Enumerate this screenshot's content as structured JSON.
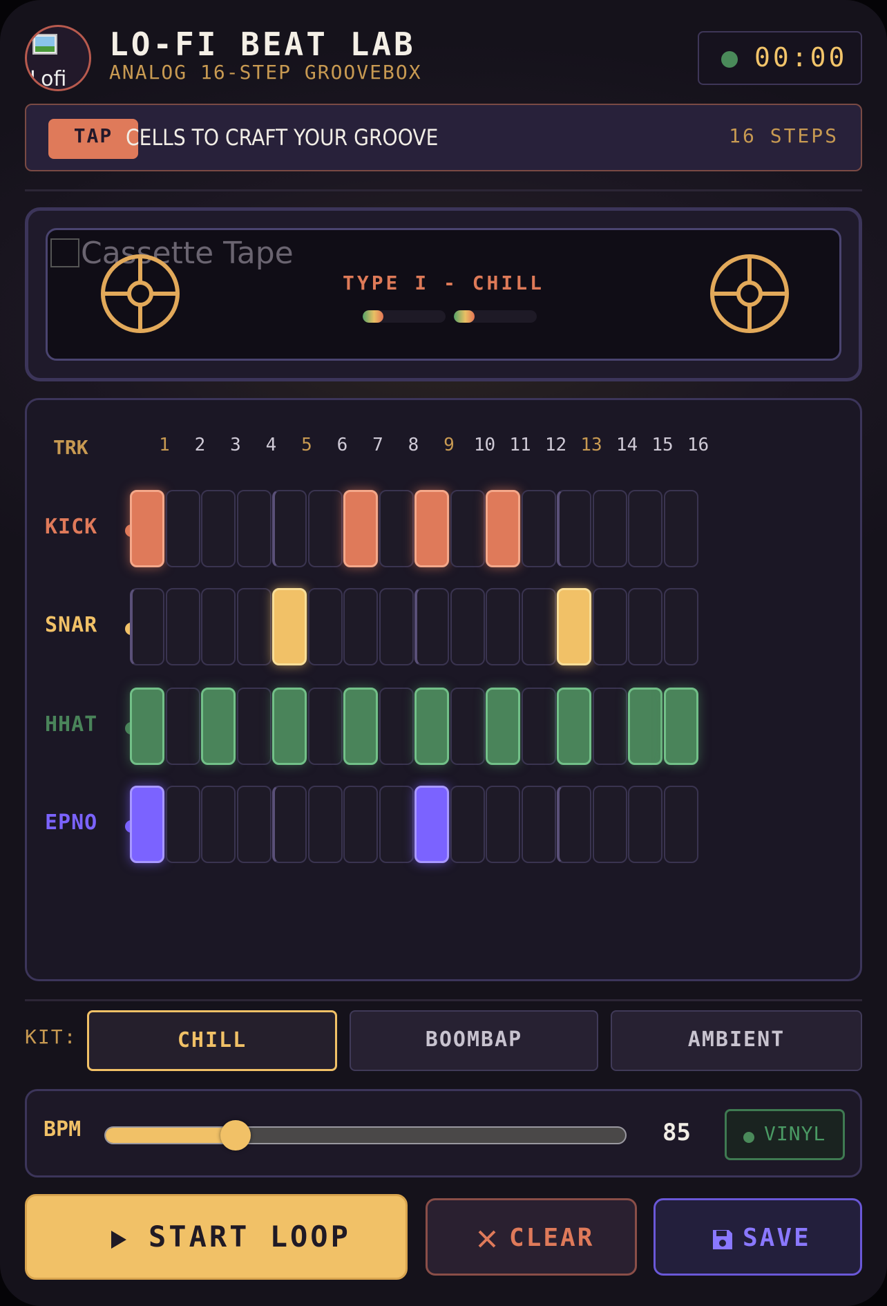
{
  "header": {
    "logo_alt": "Lofi",
    "title": "LO-FI BEAT LAB",
    "subtitle": "ANALOG 16-STEP GROOVEBOX",
    "timer": "00:00",
    "timer_status_color": "#4a8a5a"
  },
  "banner": {
    "badge": "TAP",
    "text": "CELLS TO CRAFT YOUR GROOVE",
    "steps": "16 STEPS"
  },
  "cassette": {
    "image_alt": "Cassette Tape",
    "label": "TYPE I - CHILL",
    "left_reel_progress": 0.25,
    "right_reel_progress": 0.25
  },
  "sequencer": {
    "track_header": "TRK",
    "steps": [
      "1",
      "2",
      "3",
      "4",
      "5",
      "6",
      "7",
      "8",
      "9",
      "10",
      "11",
      "12",
      "13",
      "14",
      "15",
      "16"
    ],
    "tracks": [
      {
        "name": "KICK",
        "color": "#df7a5a",
        "border": "#f4a88a",
        "pattern": [
          1,
          0,
          0,
          0,
          0,
          0,
          1,
          0,
          1,
          0,
          1,
          0,
          0,
          0,
          0,
          0
        ]
      },
      {
        "name": "SNAR",
        "color": "#f1c167",
        "border": "#f8de98",
        "pattern": [
          0,
          0,
          0,
          0,
          1,
          0,
          0,
          0,
          0,
          0,
          0,
          0,
          1,
          0,
          0,
          0
        ]
      },
      {
        "name": "HHAT",
        "color": "#4a845a",
        "border": "#72c088",
        "pattern": [
          1,
          0,
          1,
          0,
          1,
          0,
          1,
          0,
          1,
          0,
          1,
          0,
          1,
          0,
          1,
          1
        ]
      },
      {
        "name": "EPNO",
        "color": "#7b63ff",
        "border": "#a898ff",
        "pattern": [
          1,
          0,
          0,
          0,
          0,
          0,
          0,
          0,
          1,
          0,
          0,
          0,
          0,
          0,
          0,
          0
        ]
      }
    ]
  },
  "kit": {
    "label": "KIT:",
    "options": [
      "CHILL",
      "BOOMBAP",
      "AMBIENT"
    ],
    "selected": "CHILL"
  },
  "tempo": {
    "label": "BPM",
    "value": "85",
    "min": 60,
    "max": 160,
    "vinyl_label": "VINYL"
  },
  "actions": {
    "start": "START LOOP",
    "clear": "CLEAR",
    "save": "SAVE"
  },
  "colors": {
    "accent": "#f1c167",
    "kick": "#df7a5a",
    "hihat": "#4a845a",
    "epiano": "#7b63ff"
  }
}
